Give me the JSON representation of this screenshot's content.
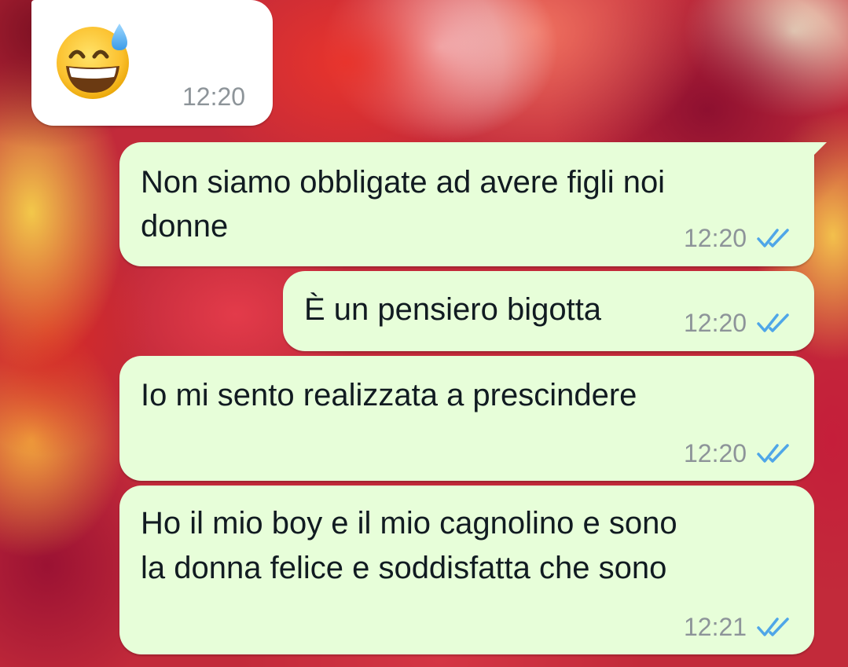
{
  "conversation": {
    "colors": {
      "incoming_bubble": "#ffffff",
      "outgoing_bubble": "#e7fed9",
      "read_ticks": "#4fa6e8",
      "timestamp": "#8d9499"
    },
    "messages": [
      {
        "direction": "incoming",
        "type": "emoji",
        "icon": "grinning-face-with-sweat-icon",
        "time": "12:20"
      },
      {
        "direction": "outgoing",
        "lines": [
          "Non siamo obbligate ad avere figli noi",
          "donne"
        ],
        "time": "12:20",
        "status": "read-double-check-icon"
      },
      {
        "direction": "outgoing",
        "lines": [
          "È un pensiero bigotta"
        ],
        "time": "12:20",
        "status": "read-double-check-icon"
      },
      {
        "direction": "outgoing",
        "lines": [
          "Io mi sento realizzata a prescindere"
        ],
        "time": "12:20",
        "status": "read-double-check-icon"
      },
      {
        "direction": "outgoing",
        "lines": [
          "Ho il mio boy e il mio cagnolino e sono",
          "la donna felice e soddisfatta che sono"
        ],
        "time": "12:21",
        "status": "read-double-check-icon"
      }
    ]
  }
}
